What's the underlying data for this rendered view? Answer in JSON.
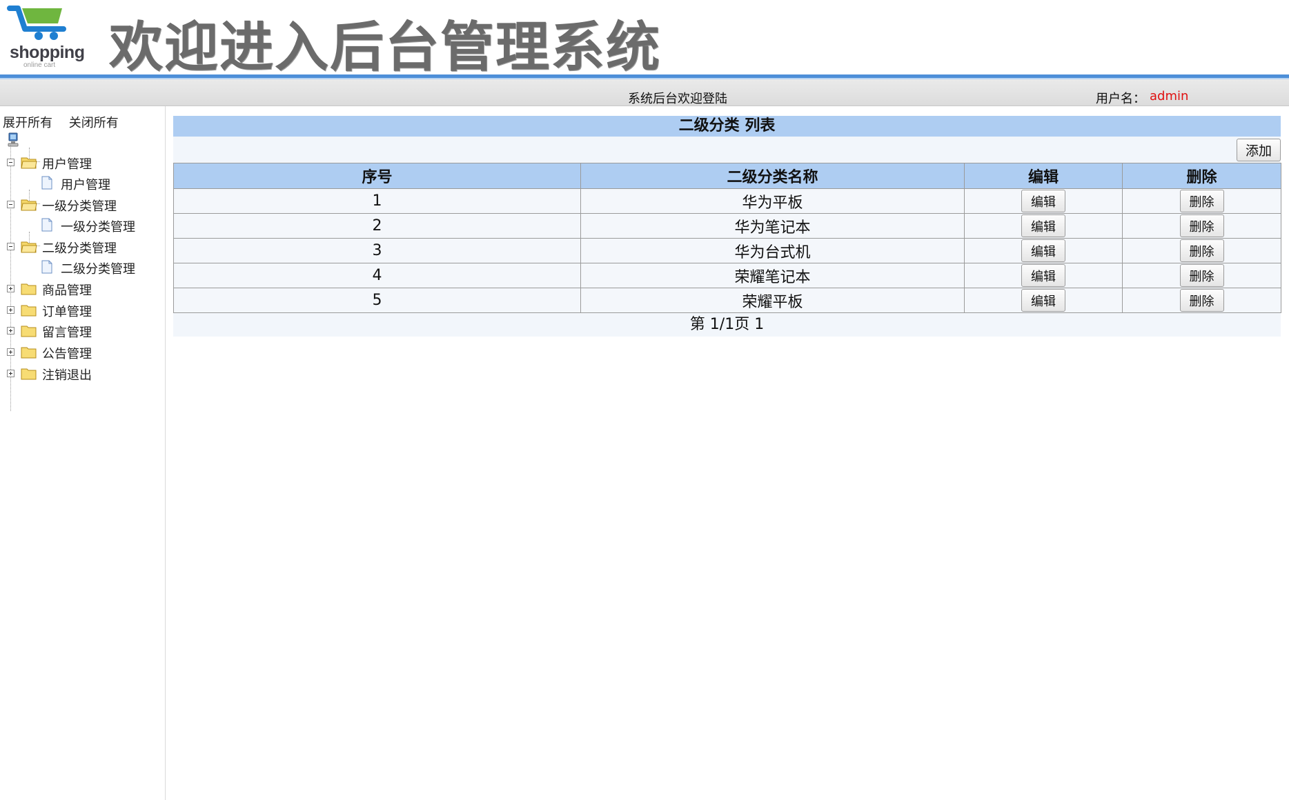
{
  "header": {
    "logo_text": "shopping",
    "logo_subtext": "online cart",
    "title": "欢迎进入后台管理系统",
    "colors": {
      "logo_green": "#6fb63f",
      "logo_blue": "#1f7fd1",
      "header_line": "#4d8fd8"
    }
  },
  "statusbar": {
    "welcome": "系统后台欢迎登陆",
    "user_label": "用户名：",
    "user_name": "admin",
    "user_name_color": "#e01010"
  },
  "sidebar": {
    "expand_all": "展开所有",
    "collapse_all": "关闭所有",
    "root_icon": "computer-icon",
    "items": [
      {
        "label": "用户管理",
        "expanded": true,
        "children": [
          {
            "label": "用户管理"
          }
        ]
      },
      {
        "label": "一级分类管理",
        "expanded": true,
        "children": [
          {
            "label": "一级分类管理"
          }
        ]
      },
      {
        "label": "二级分类管理",
        "expanded": true,
        "children": [
          {
            "label": "二级分类管理"
          }
        ]
      },
      {
        "label": "商品管理",
        "expanded": false
      },
      {
        "label": "订单管理",
        "expanded": false
      },
      {
        "label": "留言管理",
        "expanded": false
      },
      {
        "label": "公告管理",
        "expanded": false
      },
      {
        "label": "注销退出",
        "expanded": false
      }
    ]
  },
  "main": {
    "title": "二级分类 列表",
    "add_label": "添加",
    "columns": [
      "序号",
      "二级分类名称",
      "编辑",
      "删除"
    ],
    "rows": [
      {
        "id": "1",
        "name": "华为平板"
      },
      {
        "id": "2",
        "name": "华为笔记本"
      },
      {
        "id": "3",
        "name": "华为台式机"
      },
      {
        "id": "4",
        "name": "荣耀笔记本"
      },
      {
        "id": "5",
        "name": "荣耀平板"
      }
    ],
    "edit_label": "编辑",
    "delete_label": "删除",
    "pagination": "第 1/1页 1",
    "header_bg": "#aecdf2"
  }
}
